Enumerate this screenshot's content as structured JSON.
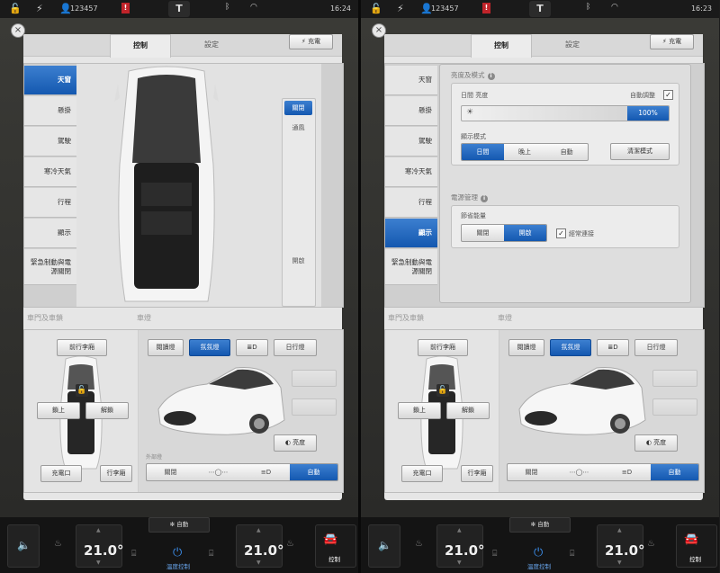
{
  "status": {
    "id_number": "123457",
    "alert": "!"
  },
  "panel": {
    "tabs": [
      "控制",
      "設定"
    ],
    "charge_label": "充電"
  },
  "left": {
    "time": "16:24",
    "menu": [
      "天窗",
      "懸掛",
      "駕駛",
      "寒冷天氣",
      "行程",
      "顯示",
      "緊急制動與電源關閉"
    ],
    "selected_menu": "天窗",
    "sunroof": {
      "options": [
        "關閉",
        "通風",
        "開啟"
      ],
      "selected": "關閉"
    },
    "doors_title": "車門及車鎖",
    "lights_title": "車燈",
    "doors": {
      "frunk": "前行李廂",
      "lock": "鎖上",
      "unlock": "解鎖",
      "charge_port": "充電口",
      "trunk": "行李廂"
    },
    "lights": {
      "reading": "閱讀燈",
      "ambient": "氛氛燈",
      "fog_icon": "fog-light-icon",
      "drl": "日行燈",
      "brightness": "亮度",
      "exterior_label": "外部燈",
      "off": "關閉",
      "auto": "自動"
    }
  },
  "right": {
    "time": "16:23",
    "menu": [
      "天窗",
      "懸掛",
      "駕駛",
      "寒冷天氣",
      "行程",
      "顯示",
      "緊急制動與電源關閉"
    ],
    "selected_menu": "顯示",
    "display": {
      "brightness_section": "亮度及模式",
      "day_brightness": "日間 亮度",
      "auto_adjust": "自動調整",
      "brightness_value": "100%",
      "brightness_fraction": 1.0,
      "mode_label": "顯示模式",
      "modes": [
        "日間",
        "晚上",
        "自動"
      ],
      "selected_mode": "日間",
      "clean_mode": "清潔模式",
      "power_section": "電源管理",
      "energy_saving": "節省能量",
      "energy_options": [
        "關閉",
        "開啟"
      ],
      "energy_selected": "開啟",
      "always_connected": "經常連接"
    },
    "doors_title": "車門及車鎖",
    "lights_title": "車燈",
    "doors": {
      "frunk": "前行李廂",
      "lock": "鎖上",
      "unlock": "解鎖",
      "charge_port": "充電口",
      "trunk": "行李廂"
    },
    "lights": {
      "reading": "閱讀燈",
      "ambient": "氛氛燈",
      "drl": "日行燈",
      "brightness": "亮度",
      "off": "關閉",
      "auto": "自動"
    }
  },
  "climate": {
    "fan": "自動",
    "left_temp": "21.0°",
    "right_temp": "21.0°",
    "center_label": "溫度控制",
    "controls_label": "控制"
  },
  "colors": {
    "accent": "#1a5fb4",
    "alert": "#c0242a"
  }
}
